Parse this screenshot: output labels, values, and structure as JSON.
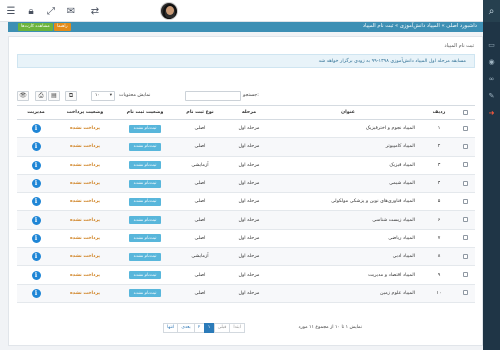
{
  "topbar": {
    "menu_icon": "list-icon",
    "icons": [
      "lock-icon",
      "expand-icon",
      "chat-icon",
      "swap-arrows-icon"
    ],
    "avatar": "user-avatar"
  },
  "sidebar": {
    "items": [
      "search-icon",
      "monitor-icon",
      "map-pin-icon",
      "link-icon",
      "pin-icon",
      "exit-icon"
    ]
  },
  "header": {
    "breadcrumb": "داشبورد اصلی » المپیاد دانش‌آموزی » ثبت نام المپیاد",
    "btn_primary": "مشاهده کارت‌ها",
    "btn_secondary": "راهنما"
  },
  "page": {
    "section_title": "ثبت نام المپیاد",
    "info_text": "مسابقه مرحله اول المپیاد دانش‌آموزی ۱۳۹۸-۹۹ به زودی برگزار خواهد شد"
  },
  "toolbar": {
    "page_size": "۱۰",
    "page_size_label": "نمایش محتویات",
    "search_label": "جستجو:",
    "search_value": ""
  },
  "table": {
    "headers": {
      "select": "",
      "row": "ردیف",
      "title": "عنوان",
      "stage": "مرحله",
      "reg_type": "نوع ثبت نام",
      "reg_status": "وضعیت ثبت نام",
      "pay_status": "وضعیت پرداخت",
      "manage": "مدیریت"
    },
    "rows": [
      {
        "row": "۱",
        "title": "المپیاد نجوم و اخترفیزیک",
        "stage": "مرحله اول",
        "reg_type": "اصلی",
        "reg_status": "ثبت‌نام نشده",
        "pay_status": "پرداخت نشده"
      },
      {
        "row": "۲",
        "title": "المپیاد کامپیوتر",
        "stage": "مرحله اول",
        "reg_type": "اصلی",
        "reg_status": "ثبت‌نام نشده",
        "pay_status": "پرداخت نشده"
      },
      {
        "row": "۳",
        "title": "المپیاد فیزیک",
        "stage": "مرحله اول",
        "reg_type": "آزمایشی",
        "reg_status": "ثبت‌نام نشده",
        "pay_status": "پرداخت نشده"
      },
      {
        "row": "۴",
        "title": "المپیاد شیمی",
        "stage": "مرحله اول",
        "reg_type": "اصلی",
        "reg_status": "ثبت‌نام نشده",
        "pay_status": "پرداخت نشده"
      },
      {
        "row": "۵",
        "title": "المپیاد فناوری‌های نوین و پزشکی مولکولی",
        "stage": "مرحله اول",
        "reg_type": "اصلی",
        "reg_status": "ثبت‌نام نشده",
        "pay_status": "پرداخت نشده"
      },
      {
        "row": "۶",
        "title": "المپیاد زیست شناسی",
        "stage": "مرحله اول",
        "reg_type": "اصلی",
        "reg_status": "ثبت‌نام نشده",
        "pay_status": "پرداخت نشده"
      },
      {
        "row": "۷",
        "title": "المپیاد ریاضی",
        "stage": "مرحله اول",
        "reg_type": "اصلی",
        "reg_status": "ثبت‌نام نشده",
        "pay_status": "پرداخت نشده"
      },
      {
        "row": "۸",
        "title": "المپیاد ادبی",
        "stage": "مرحله اول",
        "reg_type": "آزمایشی",
        "reg_status": "ثبت‌نام نشده",
        "pay_status": "پرداخت نشده"
      },
      {
        "row": "۹",
        "title": "المپیاد اقتصاد و مدیریت",
        "stage": "مرحله اول",
        "reg_type": "اصلی",
        "reg_status": "ثبت‌نام نشده",
        "pay_status": "پرداخت نشده"
      },
      {
        "row": "۱۰",
        "title": "المپیاد علوم زمین",
        "stage": "مرحله اول",
        "reg_type": "اصلی",
        "reg_status": "ثبت‌نام نشده",
        "pay_status": "پرداخت نشده"
      }
    ]
  },
  "pager": {
    "info": "نمایش ۱ تا ۱۰ از مجموع ۱۱ مورد",
    "first": "ابتدا",
    "prev": "قبلی",
    "pages": [
      "۱",
      "۲"
    ],
    "next": "بعدی",
    "last": "انتها"
  },
  "colors": {
    "header": "#3d8fb4",
    "sidebar": "#1f3546",
    "register_button": "#58b6db",
    "unpaid": "#d08426",
    "info_icon": "#1f86d6"
  }
}
